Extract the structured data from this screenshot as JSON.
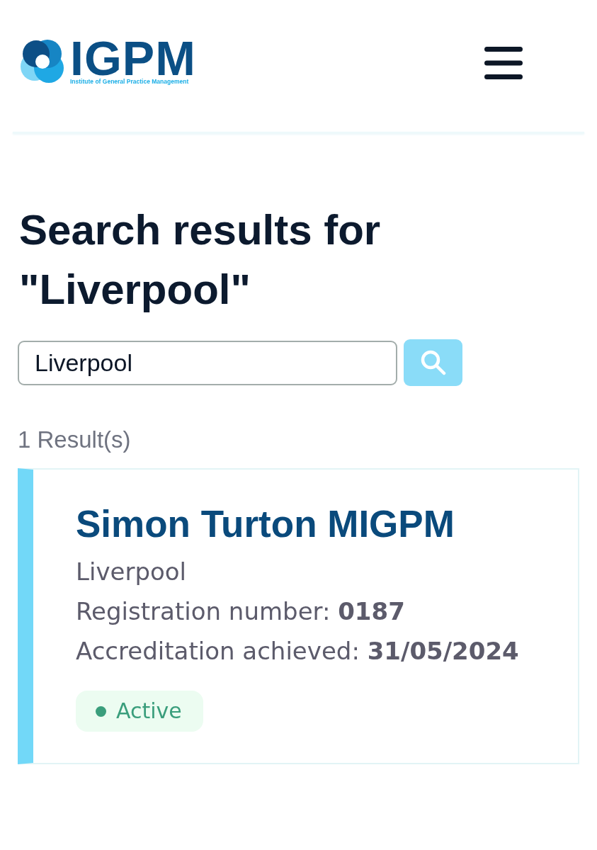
{
  "header": {
    "logo": {
      "wordmark": "IGPM",
      "tagline": "Institute of General Practice Management"
    }
  },
  "heading": "Search results for \"Liverpool\"",
  "search": {
    "value": "Liverpool"
  },
  "results_count": "1 Result(s)",
  "results": [
    {
      "name": "Simon Turton MIGPM",
      "details": [
        "Liverpool",
        "Registration number: **0187**",
        "Accreditation achieved: **31/05/2024**"
      ],
      "status": {
        "label": "Active",
        "color": "#3a9e7c"
      }
    }
  ]
}
